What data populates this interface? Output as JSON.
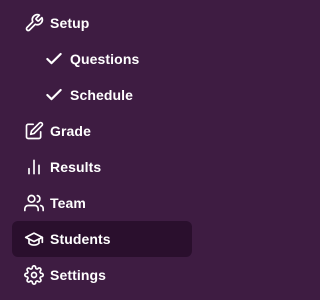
{
  "colors": {
    "background": "#3e1c42",
    "active_background": "#2a0f2d",
    "text": "#ffffff"
  },
  "nav": {
    "items": [
      {
        "label": "Setup",
        "icon": "wrench-icon",
        "active": false
      },
      {
        "label": "Questions",
        "icon": "check-icon",
        "active": false,
        "sub": true
      },
      {
        "label": "Schedule",
        "icon": "check-icon",
        "active": false,
        "sub": true
      },
      {
        "label": "Grade",
        "icon": "edit-icon",
        "active": false
      },
      {
        "label": "Results",
        "icon": "bar-chart-icon",
        "active": false
      },
      {
        "label": "Team",
        "icon": "users-icon",
        "active": false
      },
      {
        "label": "Students",
        "icon": "graduation-cap-icon",
        "active": true
      },
      {
        "label": "Settings",
        "icon": "gear-icon",
        "active": false
      }
    ]
  }
}
